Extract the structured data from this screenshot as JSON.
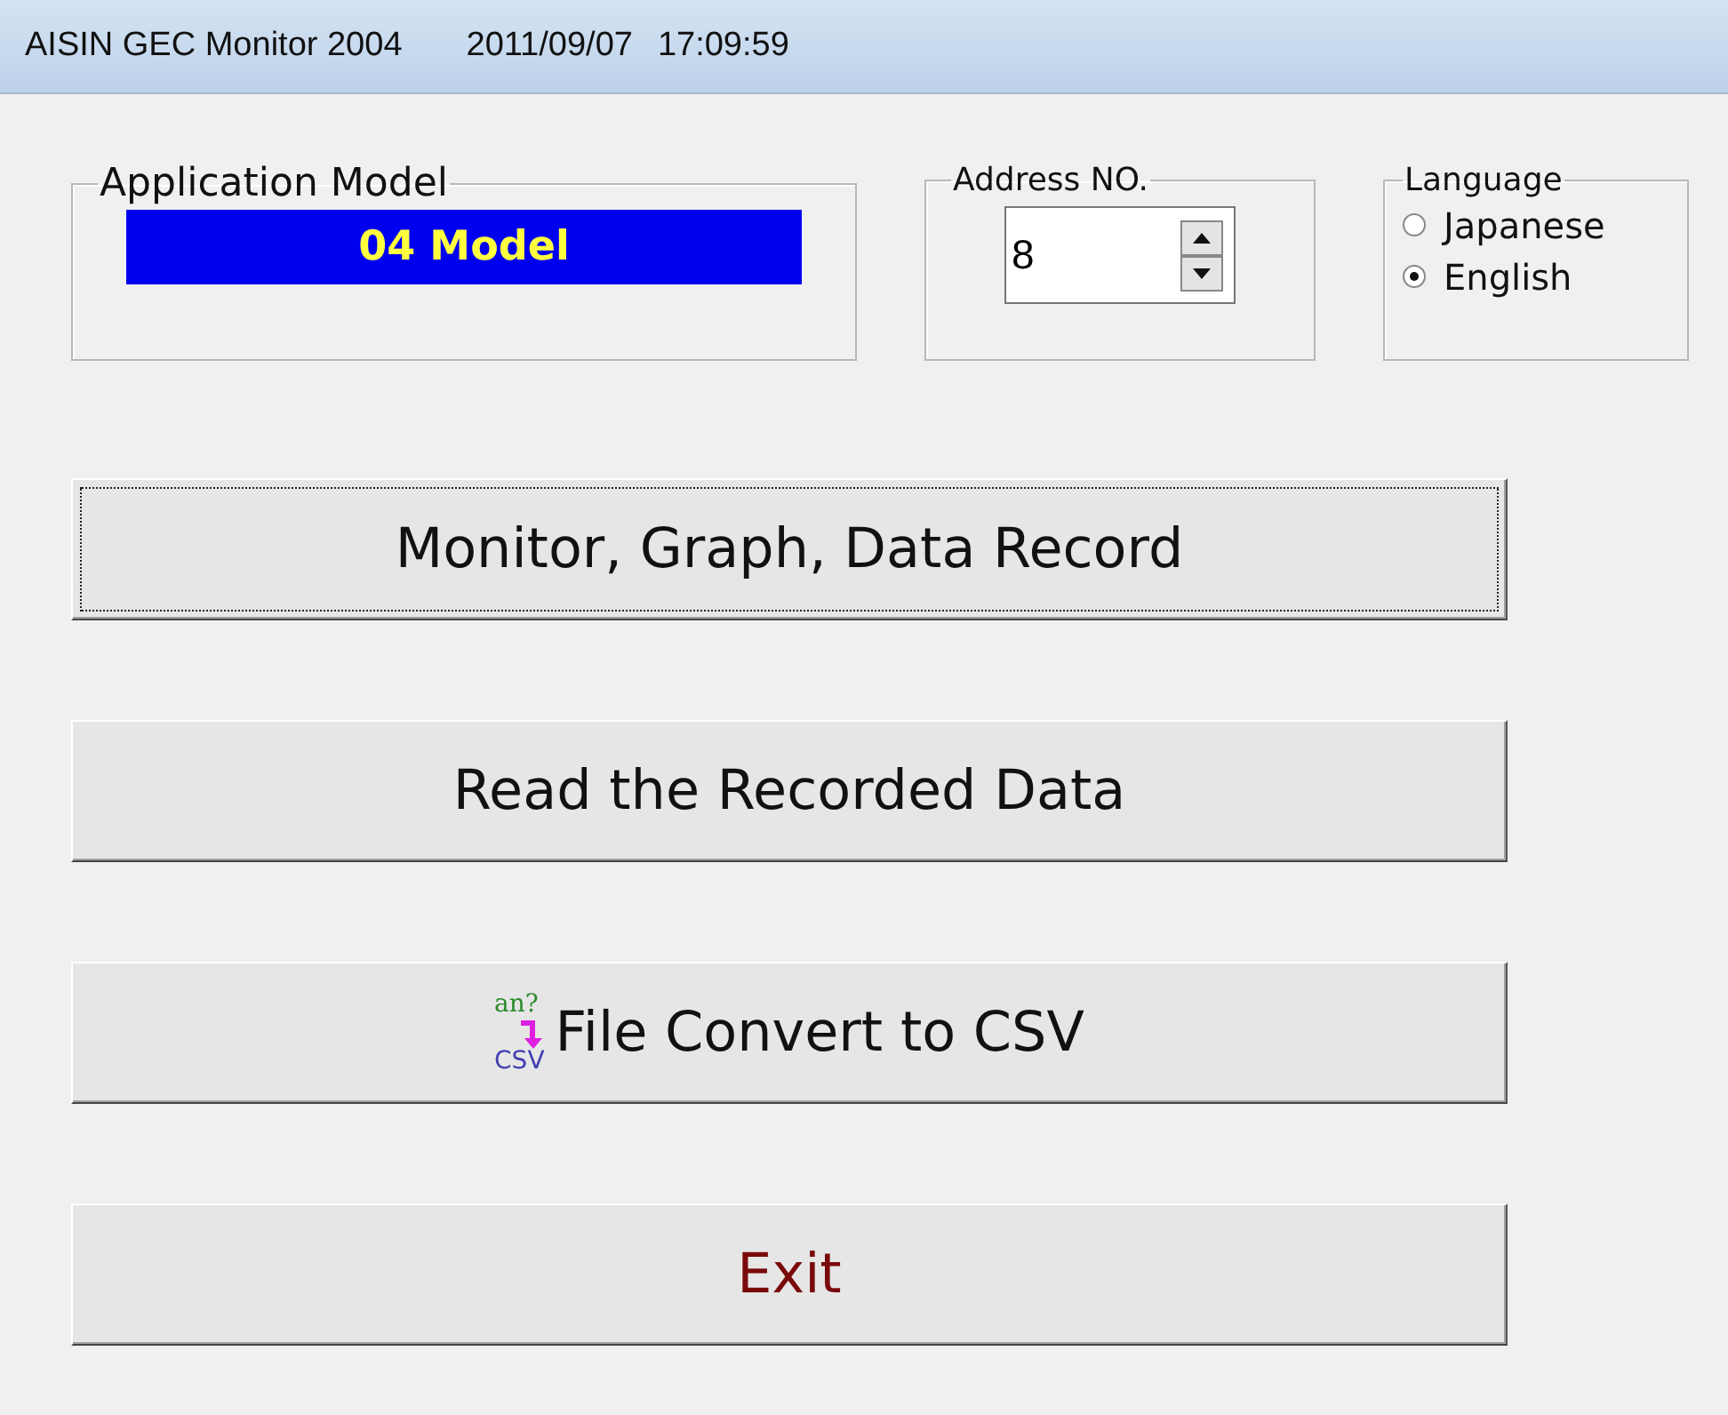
{
  "window": {
    "title": "AISIN GEC Monitor 2004",
    "date": "2011/09/07",
    "time": "17:09:59"
  },
  "application_model": {
    "label": "Application Model",
    "value": "04 Model"
  },
  "address": {
    "label": "Address NO.",
    "value": "8"
  },
  "language": {
    "label": "Language",
    "options": [
      {
        "label": "Japanese",
        "selected": false
      },
      {
        "label": "English",
        "selected": true
      }
    ]
  },
  "buttons": [
    {
      "label": "Monitor, Graph, Data Record",
      "focused": true,
      "kind": "plain"
    },
    {
      "label": "Read the Recorded Data",
      "focused": false,
      "kind": "plain"
    },
    {
      "label": "File Convert to CSV",
      "focused": false,
      "kind": "convert",
      "icon_top": "an?",
      "icon_bottom": "CSV"
    },
    {
      "label": "Exit",
      "focused": false,
      "kind": "exit"
    }
  ]
}
